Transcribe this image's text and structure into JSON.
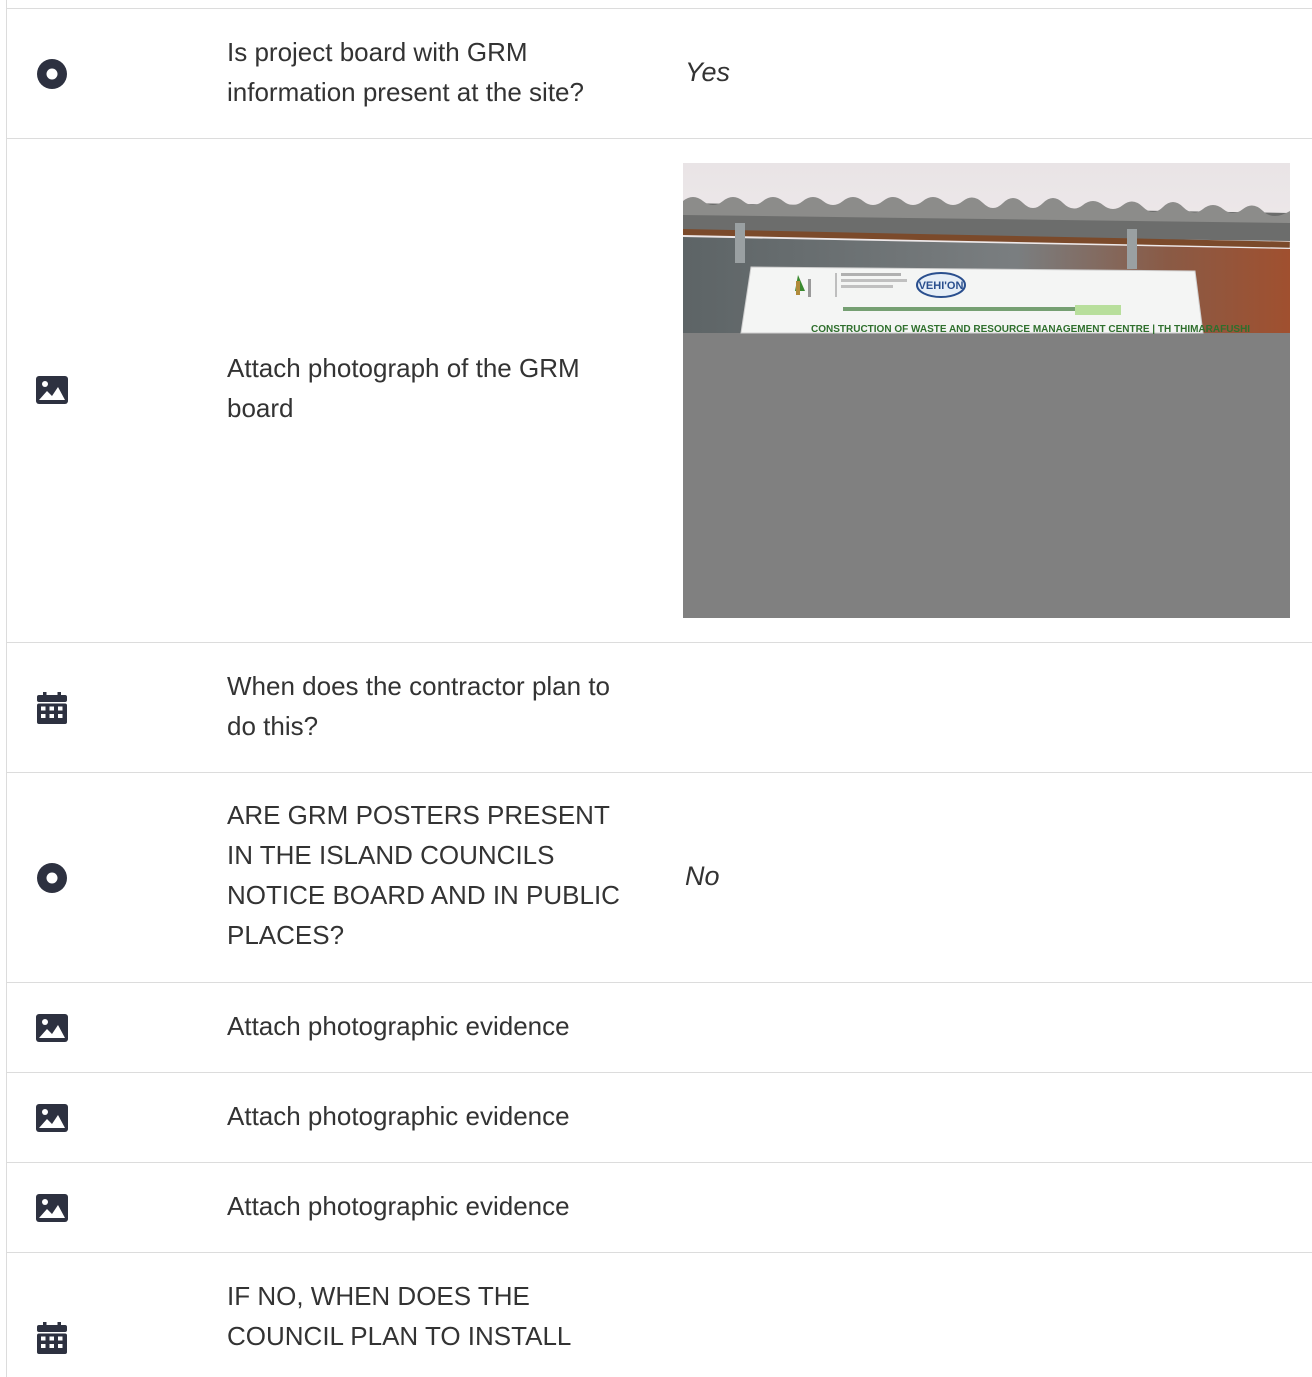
{
  "rows": [
    {
      "icon": "radio-icon",
      "question": "Is project board with GRM information present at the site?",
      "answer": "Yes"
    },
    {
      "icon": "image-icon",
      "question": "Attach photograph of the GRM board",
      "answer": ""
    },
    {
      "icon": "calendar-icon",
      "question": "When does the contractor plan to do this?",
      "answer": ""
    },
    {
      "icon": "radio-icon",
      "question": "ARE GRM POSTERS PRESENT IN THE ISLAND COUNCILS NOTICE BOARD AND IN PUBLIC PLACES?",
      "answer": "No"
    },
    {
      "icon": "image-icon",
      "question": "Attach photographic evidence",
      "answer": ""
    },
    {
      "icon": "image-icon",
      "question": "Attach photographic evidence",
      "answer": ""
    },
    {
      "icon": "image-icon",
      "question": "Attach photographic evidence",
      "answer": ""
    },
    {
      "icon": "calendar-icon",
      "question": "IF NO, WHEN DOES THE COUNCIL PLAN TO INSTALL",
      "answer": ""
    }
  ],
  "photo": {
    "board_text": "CONSTRUCTION OF WASTE AND RESOURCE MANAGEMENT CENTRE | TH THIMARAFUSHI",
    "logo_text": "VEHI'ON"
  },
  "colors": {
    "icon": "#2d3140",
    "border": "#dcdcdc",
    "text": "#333333",
    "placeholder": "#808080"
  }
}
